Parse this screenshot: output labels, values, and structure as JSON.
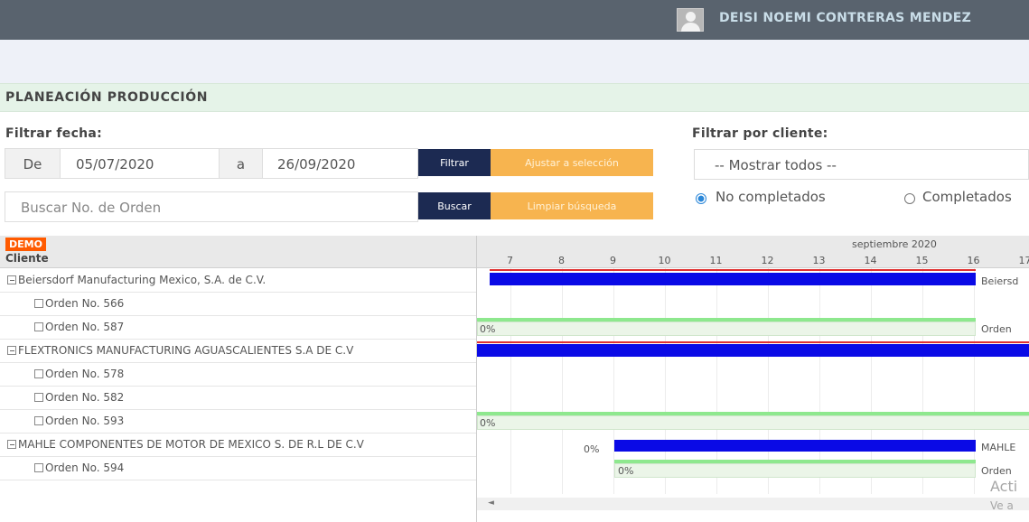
{
  "header": {
    "user_name": "DEISI NOEMI CONTRERAS MENDEZ"
  },
  "page": {
    "title": "PLANEACIÓN PRODUCCIÓN"
  },
  "date_filter": {
    "label": "Filtrar fecha:",
    "from_prefix": "De",
    "from_value": "05/07/2020",
    "separator": "a",
    "to_value": "26/09/2020",
    "filter_button": "Filtrar",
    "adjust_button": "Ajustar a selección"
  },
  "order_search": {
    "placeholder": "Buscar No. de Orden",
    "search_button": "Buscar",
    "clear_button": "Limpiar búsqueda"
  },
  "client_filter": {
    "label": "Filtrar por cliente:",
    "selected": "-- Mostrar todos --"
  },
  "status_filter": {
    "options": [
      {
        "label": "No completados",
        "checked": true
      },
      {
        "label": "Completados",
        "checked": false
      }
    ]
  },
  "gantt": {
    "demo_badge": "DEMO",
    "client_column_header": "Cliente",
    "month": "septiembre 2020",
    "days": [
      "7",
      "8",
      "9",
      "10",
      "11",
      "12",
      "13",
      "14",
      "15",
      "16",
      "17"
    ],
    "rows": [
      {
        "label": "Beiersdorf Manufacturing Mexico, S.A. de C.V.",
        "type": "client"
      },
      {
        "label": "Orden No. 566",
        "type": "order"
      },
      {
        "label": "Orden No. 587",
        "type": "order"
      },
      {
        "label": "FLEXTRONICS MANUFACTURING AGUASCALIENTES S.A DE C.V",
        "type": "client"
      },
      {
        "label": "Orden No. 578",
        "type": "order"
      },
      {
        "label": "Orden No. 582",
        "type": "order"
      },
      {
        "label": "Orden No. 593",
        "type": "order"
      },
      {
        "label": "MAHLE COMPONENTES DE MOTOR DE MEXICO S. DE R.L DE C.V",
        "type": "client"
      },
      {
        "label": "Orden No. 594",
        "type": "order"
      }
    ],
    "bar_labels": {
      "beiersdorf_right": "Beiersd",
      "order587_progress": "0%",
      "order587_right": "Orden",
      "order593_progress": "0%",
      "mahle_left_progress": "0%",
      "mahle_right": "MAHLE",
      "order594_progress": "0%",
      "order594_right": "Orden"
    }
  },
  "watermark": {
    "line1": "Acti",
    "line2": "Ve a"
  }
}
